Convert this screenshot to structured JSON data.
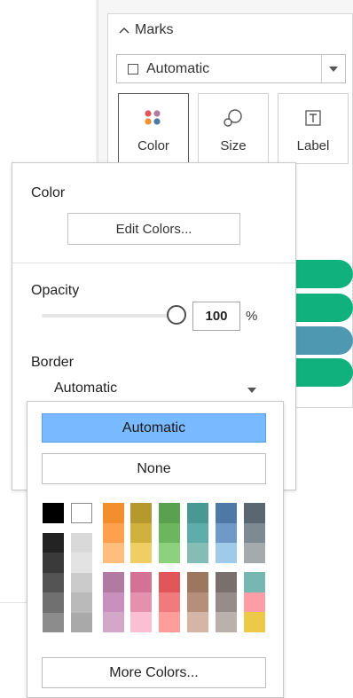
{
  "marks": {
    "header": "Marks",
    "mark_type": "Automatic",
    "buttons": [
      {
        "label": "Color",
        "icon": "color-dots-icon"
      },
      {
        "label": "Size",
        "icon": "size-icon"
      },
      {
        "label": "Label",
        "icon": "label-icon"
      }
    ]
  },
  "bars": [
    {
      "color": "#10b17d"
    },
    {
      "color": "#10b17d"
    },
    {
      "color": "#4e98b2"
    },
    {
      "color": "#10b17d"
    }
  ],
  "color_popup": {
    "color_title": "Color",
    "edit_colors": "Edit Colors...",
    "opacity_title": "Opacity",
    "opacity_value": "100",
    "opacity_unit": "%",
    "opacity_percent": 100,
    "border_title": "Border",
    "border_value": "Automatic"
  },
  "border_dropdown": {
    "automatic": "Automatic",
    "none": "None",
    "more_colors": "More Colors...",
    "grays": [
      "#000000",
      "#ffffff"
    ],
    "gray_column_1": [
      "#232323",
      "#3a3a3a",
      "#545454",
      "#707070",
      "#8c8c8c"
    ],
    "gray_column_2": [
      "#d9d9d9",
      "#e3e3e3",
      "#cbcbcb",
      "#bababa",
      "#a9a9a9"
    ],
    "palette_top": [
      [
        "#f28e2b",
        "#ffa04f",
        "#ffbe7d"
      ],
      [
        "#b6992d",
        "#d0b13d",
        "#f1ce63"
      ],
      [
        "#59a14f",
        "#6cb65f",
        "#8cd17d"
      ],
      [
        "#499894",
        "#5fadab",
        "#86bcb6"
      ],
      [
        "#4e79a7",
        "#6f99c6",
        "#a0cbe8"
      ],
      [
        "#5b6770",
        "#7e8a92",
        "#a5aaad"
      ]
    ],
    "palette_bottom": [
      [
        "#b07aa1",
        "#c98fbd",
        "#d4a6c8"
      ],
      [
        "#d37295",
        "#e590ad",
        "#fabfd2"
      ],
      [
        "#e15759",
        "#f07a7c",
        "#ff9d9a"
      ],
      [
        "#9d7660",
        "#b68f7a",
        "#d7b5a6"
      ],
      [
        "#79706e",
        "#968d8a",
        "#bab0ac"
      ],
      [
        "#76b7b2",
        "#ff9da7",
        "#edc948"
      ]
    ]
  },
  "colors": {
    "accent_selected": "#78b9ff"
  }
}
